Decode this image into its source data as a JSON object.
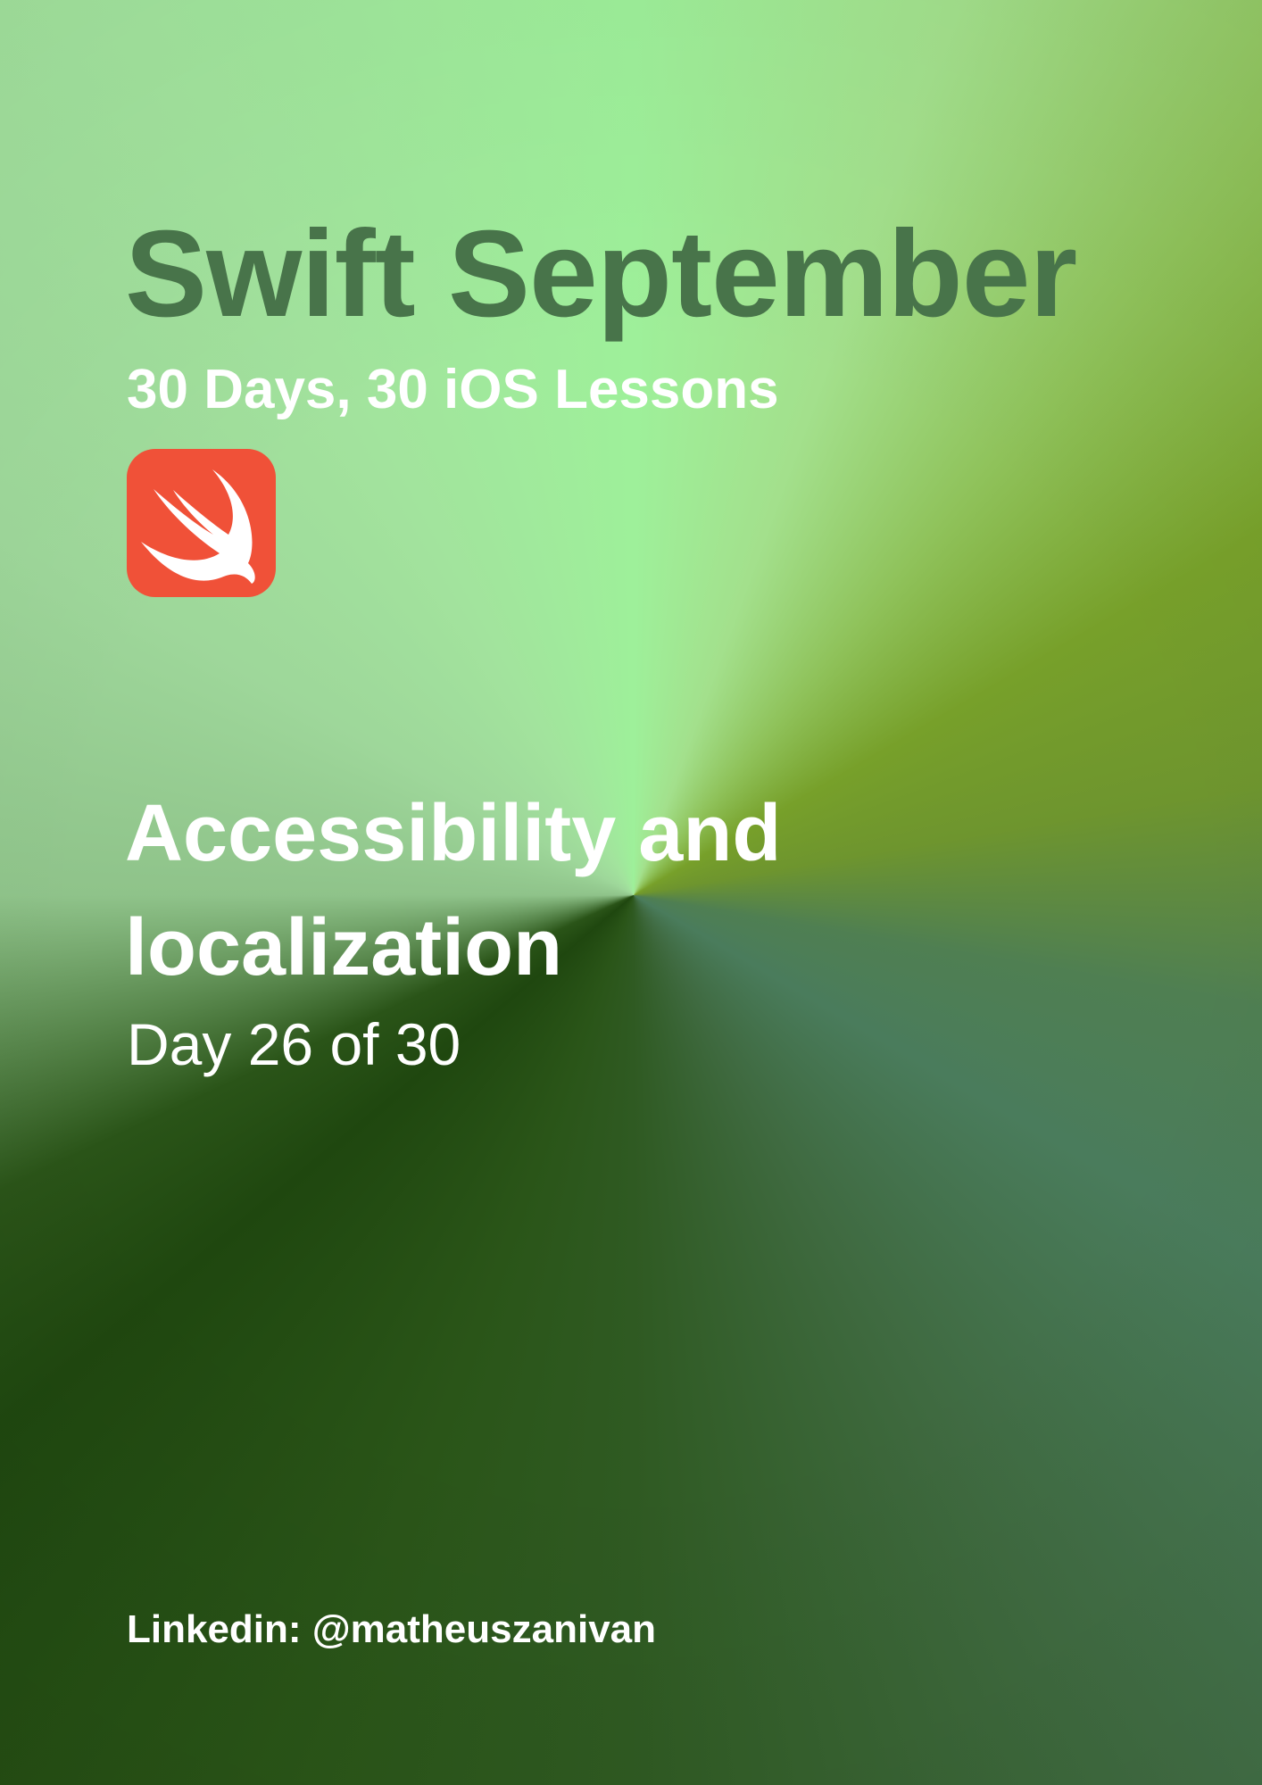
{
  "poster": {
    "title": "Swift September",
    "subtitle": "30 Days, 30 iOS Lessons",
    "logo": {
      "icon": "swift-logo-icon",
      "background_color": "#f05138",
      "glyph_color": "#ffffff"
    },
    "lesson_title": "Accessibility and localization",
    "day_label": "Day 26 of 30",
    "credit": "Linkedin: @matheuszanivan"
  },
  "colors": {
    "title_color": "#48744a",
    "text_color": "#ffffff",
    "gradient_light": "#9ef09a",
    "gradient_olive": "#77a02a",
    "gradient_dark": "#1f470f"
  }
}
